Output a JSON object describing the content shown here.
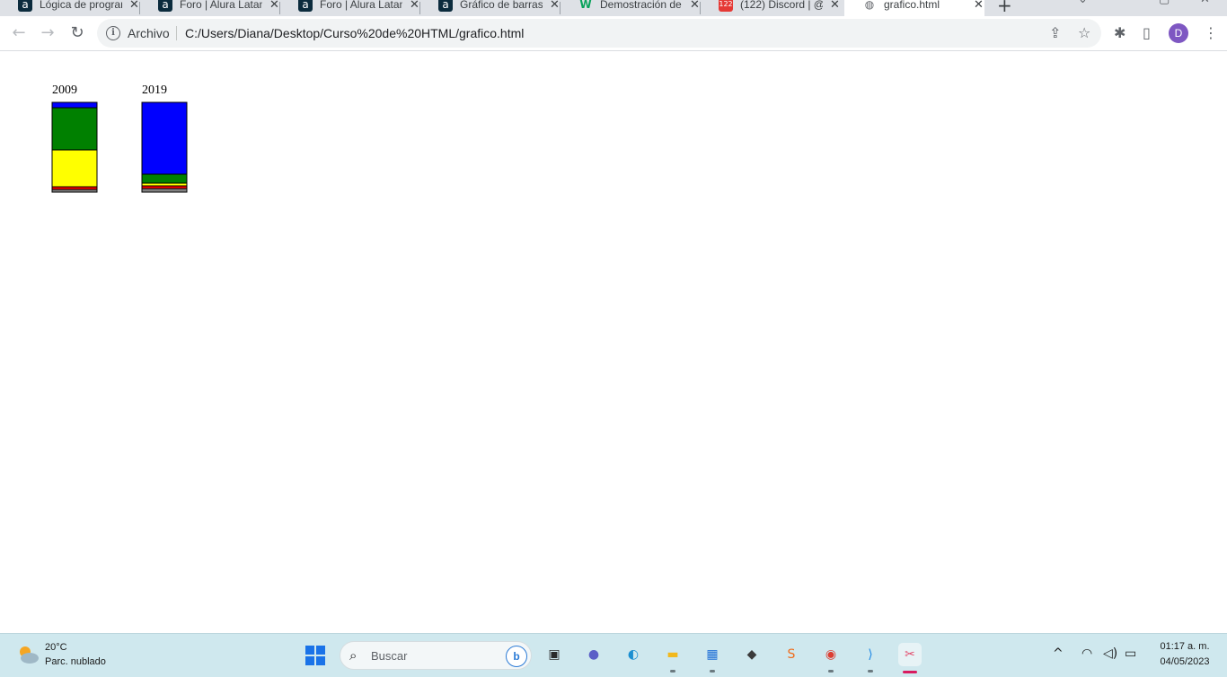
{
  "browser": {
    "tabs": [
      {
        "title": "Lógica de programación",
        "favicon": "alura-icon"
      },
      {
        "title": "Foro | Alura Latam",
        "favicon": "alura-icon"
      },
      {
        "title": "Foro | Alura Latam",
        "favicon": "alura-icon"
      },
      {
        "title": "Gráfico de barras",
        "favicon": "alura-icon"
      },
      {
        "title": "Demostración de",
        "favicon": "w-icon"
      },
      {
        "title": "(122) Discord | @",
        "favicon": "discord-icon",
        "badge": "122"
      },
      {
        "title": "grafico.html",
        "favicon": "globe-icon",
        "active": true
      }
    ],
    "new_tab_label": "+",
    "toolbar": {
      "back_icon": "←",
      "forward_icon": "→",
      "reload_icon": "↻",
      "site_chip": "Archivo",
      "url": "C:/Users/Diana/Desktop/Curso%20de%20HTML/grafico.html",
      "share_icon": "⇪",
      "star_icon": "☆",
      "extensions_icon": "✱",
      "sidepanel_icon": "▯",
      "profile_initial": "D",
      "menu_icon": "⋮"
    }
  },
  "page": {
    "chart_data": {
      "type": "bar",
      "stacked": true,
      "categories": [
        "2009",
        "2019"
      ],
      "series_colors": [
        "#0000ff",
        "#008000",
        "#ffff00",
        "#ff0000",
        "#808080"
      ],
      "series": [
        {
          "color": "#0000ff",
          "values": [
            6,
            80
          ]
        },
        {
          "color": "#008000",
          "values": [
            47,
            10
          ]
        },
        {
          "color": "#ffff00",
          "values": [
            41,
            3
          ]
        },
        {
          "color": "#ff0000",
          "values": [
            3,
            3
          ]
        },
        {
          "color": "#808080",
          "values": [
            3,
            4
          ]
        }
      ],
      "total": 100,
      "title": "",
      "xlabel": "",
      "ylabel": ""
    }
  },
  "taskbar": {
    "weather": {
      "temp": "20°C",
      "desc": "Parc. nublado"
    },
    "search_label": "Buscar",
    "bing_label": "b",
    "apps": [
      {
        "name": "task-view-icon",
        "glyph": "▣",
        "color": "#2a2a2a"
      },
      {
        "name": "chat-icon",
        "glyph": "●",
        "color": "#5b5fc7"
      },
      {
        "name": "edge-icon",
        "glyph": "◐",
        "color": "#1b8fd1"
      },
      {
        "name": "file-explorer-icon",
        "glyph": "▬",
        "color": "#f2b81c"
      },
      {
        "name": "store-icon",
        "glyph": "▦",
        "color": "#1f6fd6"
      },
      {
        "name": "maps-icon",
        "glyph": "◆",
        "color": "#3b3b3b"
      },
      {
        "name": "sublime-icon",
        "glyph": "S",
        "color": "#ef6c1c"
      },
      {
        "name": "chrome-icon",
        "glyph": "◉",
        "color": "#dc3e32"
      },
      {
        "name": "vscode-icon",
        "glyph": "⟩",
        "color": "#1e88e5"
      },
      {
        "name": "snipping-tool-icon",
        "glyph": "✂",
        "color": "#e24a6b"
      }
    ],
    "tray": {
      "chevron": "^",
      "wifi": "wifi-icon",
      "volume": "volume-icon",
      "battery": "battery-icon"
    },
    "clock": {
      "time": "01:17 a. m.",
      "date": "04/05/2023"
    }
  }
}
